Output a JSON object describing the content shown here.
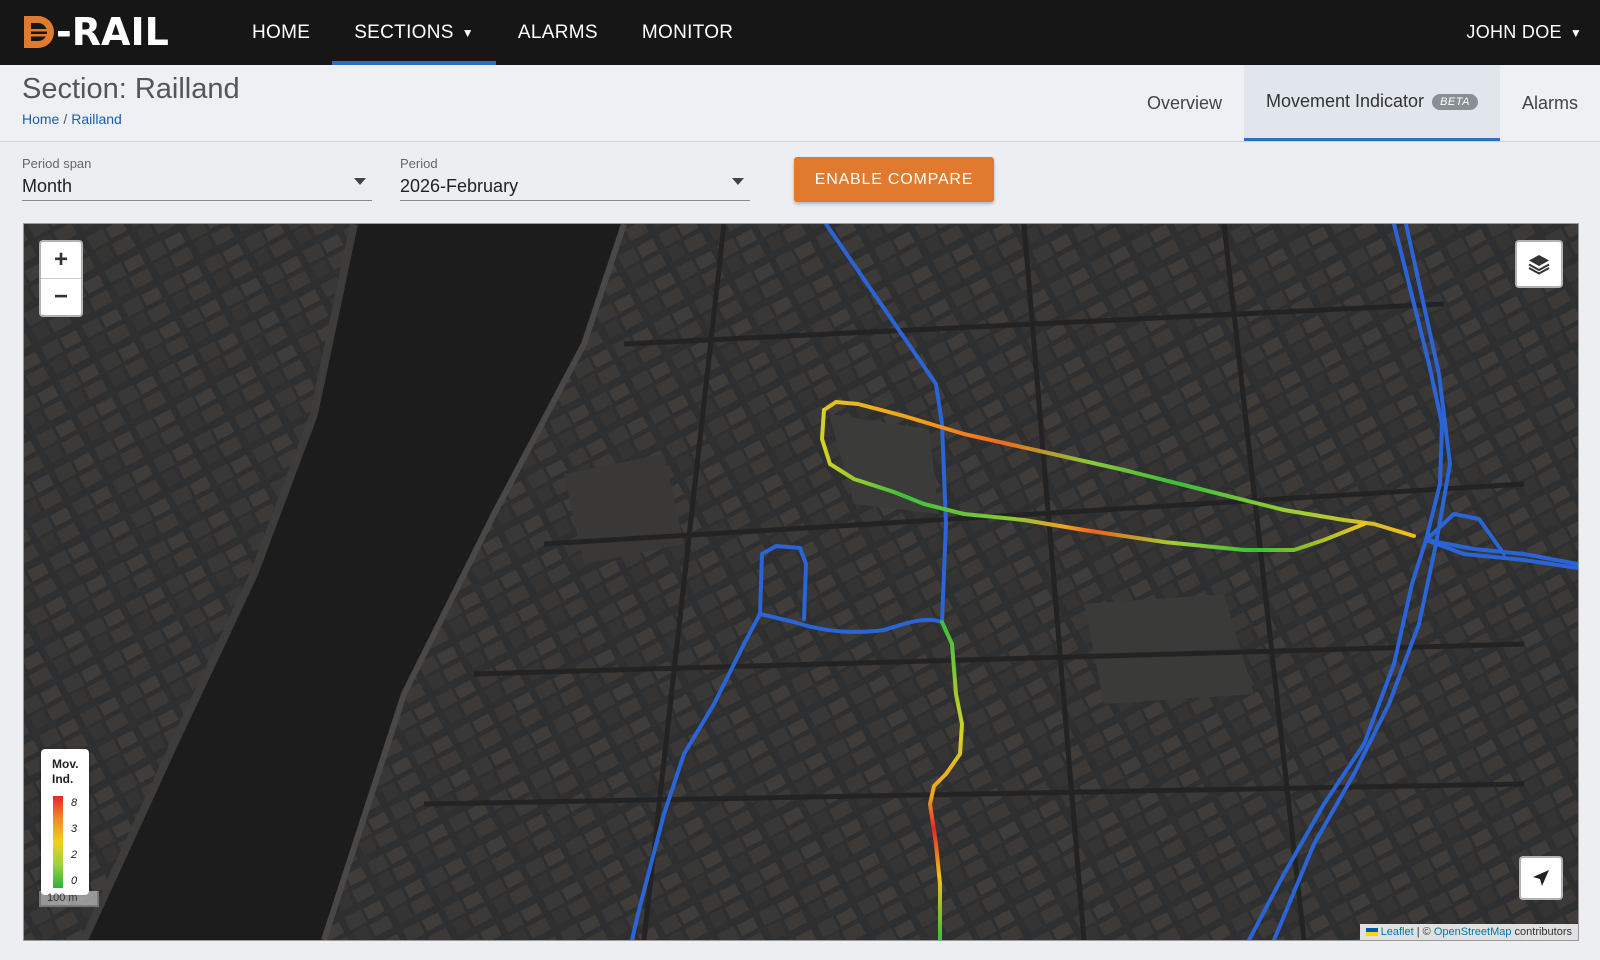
{
  "app": {
    "logo_text": "D-RAIL",
    "accent_color": "#e07a2e",
    "nav_active_color": "#2b6fc4"
  },
  "nav": {
    "items": [
      {
        "label": "HOME"
      },
      {
        "label": "SECTIONS"
      },
      {
        "label": "ALARMS"
      },
      {
        "label": "MONITOR"
      }
    ],
    "active": "SECTIONS",
    "user": "JOHN DOE"
  },
  "page": {
    "title": "Section: Railland",
    "breadcrumb": {
      "home": "Home",
      "separator": "/",
      "current": "Railland"
    },
    "tabs": [
      {
        "label": "Overview"
      },
      {
        "label": "Movement Indicator",
        "badge": "BETA"
      },
      {
        "label": "Alarms"
      }
    ],
    "active_tab": "Movement Indicator"
  },
  "filters": {
    "period_span": {
      "label": "Period span",
      "value": "Month"
    },
    "period": {
      "label": "Period",
      "value": "2026-February"
    },
    "compare_button": "ENABLE COMPARE"
  },
  "map": {
    "zoom_in": "+",
    "zoom_out": "−",
    "layers_icon": "layers-icon",
    "locate_icon": "navigation-arrow-icon",
    "legend": {
      "title_line1": "Mov.",
      "title_line2": "Ind.",
      "ticks": [
        "8",
        "3",
        "2",
        "0"
      ]
    },
    "scale": "100 m",
    "attribution": {
      "leaflet": "Leaflet",
      "sep": " | © ",
      "osm": "OpenStreetMap",
      "suffix": " contributors"
    },
    "track_color": "#2a64d6"
  }
}
